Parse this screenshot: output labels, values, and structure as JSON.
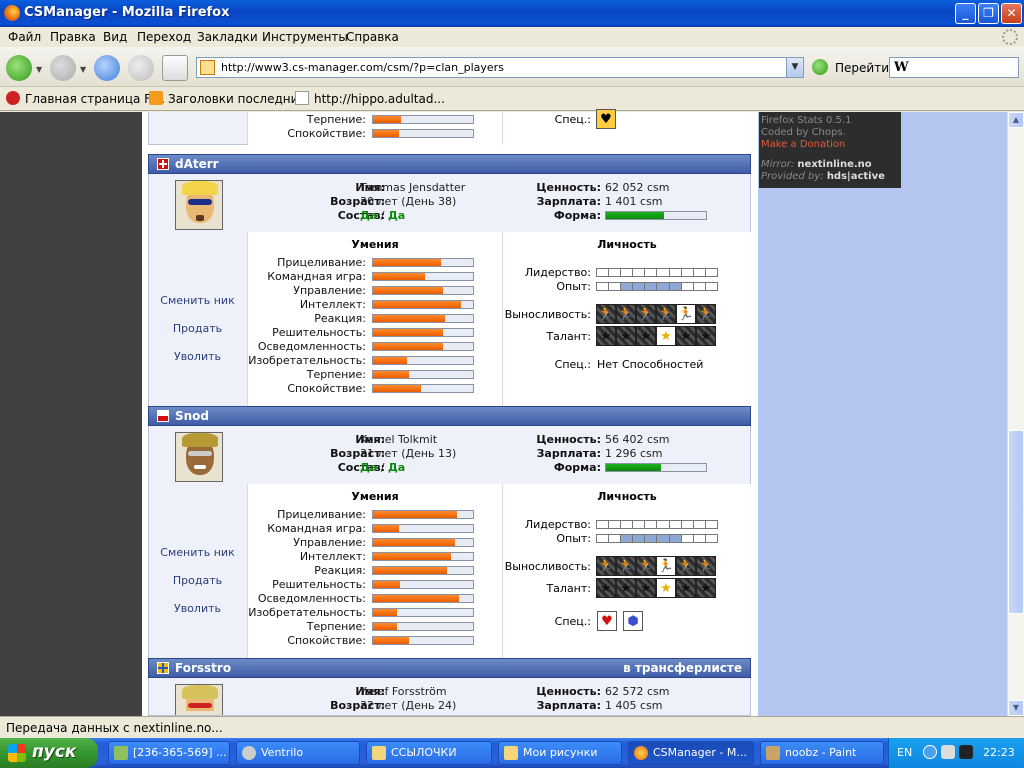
{
  "window": {
    "title": "CSManager - Mozilla Firefox"
  },
  "menu": [
    "Файл",
    "Правка",
    "Вид",
    "Переход",
    "Закладки",
    "Инструменты",
    "Справка"
  ],
  "nav": {
    "url": "http://www3.cs-manager.com/csm/?p=clan_players",
    "go_label": "Перейти",
    "search_engine": "W"
  },
  "bookmarks": [
    "Главная страница Fi...",
    "Заголовки последни...",
    "http://hippo.adultad..."
  ],
  "stats": {
    "line1": "Firefox Stats 0.5.1",
    "line2": "Coded by Chops.",
    "line3": "Make a Donation",
    "mirror_label": "Mirror:",
    "mirror_value": "nextinline.no",
    "provided_label": "Provided by:",
    "provided_value": "hds|active"
  },
  "labels": {
    "name": "Имя:",
    "age": "Возраст:",
    "squad": "Состав:",
    "value": "Ценность:",
    "salary": "Зарплата:",
    "form": "Форма:",
    "skills_head": "Умения",
    "personality_head": "Личность",
    "change_nick": "Сменить ник",
    "sell": "Продать",
    "fire": "Уволить",
    "leadership": "Лидерство:",
    "experience": "Опыт:",
    "stamina": "Выносливость:",
    "talent": "Талант:",
    "spec": "Спец.:",
    "slash": "/",
    "skills": [
      "Прицеливание:",
      "Командная игра:",
      "Управление:",
      "Интеллект:",
      "Реакция:",
      "Решительность:",
      "Осведомленность:",
      "Изобретательность:",
      "Терпение:",
      "Спокойствие:"
    ]
  },
  "top_partial": {
    "rows": [
      "Терпение:",
      "Спокойствие:"
    ],
    "fills": [
      0.28,
      0.26
    ],
    "spec_label": "Спец.:"
  },
  "players": [
    {
      "nick": "dAterr",
      "flag_color": "#d01010",
      "transfer": "",
      "name": "Tommas Jensdatter",
      "age": "30 лет (День 38)",
      "squad_a": "Да",
      "squad_b": "Да",
      "value": "62 052 csm",
      "salary": "1 401 csm",
      "form": 0.58,
      "skill_fills": [
        0.68,
        0.52,
        0.7,
        0.88,
        0.72,
        0.7,
        0.7,
        0.34,
        0.36,
        0.48
      ],
      "leadership": 0,
      "experience": 7,
      "stamina_lit": 4,
      "talent_lit": 3,
      "spec_text": "Нет Способностей"
    },
    {
      "nick": "Snod",
      "flag_color": "#d01010",
      "transfer": "",
      "name": "Kornel Tolkmit",
      "age": "31 лет (День 13)",
      "squad_a": "Да",
      "squad_b": "Да",
      "value": "56 402 csm",
      "salary": "1 296 csm",
      "form": 0.55,
      "skill_fills": [
        0.84,
        0.26,
        0.82,
        0.78,
        0.74,
        0.27,
        0.86,
        0.24,
        0.24,
        0.36
      ],
      "leadership": 0,
      "experience": 7,
      "stamina_lit": 3,
      "talent_lit": 3,
      "spec_text": ""
    },
    {
      "nick": "Forsstro",
      "flag_color": "#f0c000",
      "transfer": "в трансферлисте",
      "name": "Yosef Forsström",
      "age": "32 лет (День 24)",
      "value": "62 572 csm",
      "salary": "1 405 csm"
    }
  ],
  "status": "Передача данных с nextinline.no...",
  "taskbar": {
    "start": "пуск",
    "tasks": [
      "[236-365-569] ...",
      "Ventrilo",
      "ССЫЛОЧКИ",
      "Мои рисунки",
      "CSManager - M...",
      "noobz - Paint"
    ],
    "lang": "EN",
    "clock": "22:23"
  },
  "colors": {
    "accent": "#3e5da6",
    "skill_bar": "#e85d00",
    "form_bar": "#0a8a0a"
  }
}
